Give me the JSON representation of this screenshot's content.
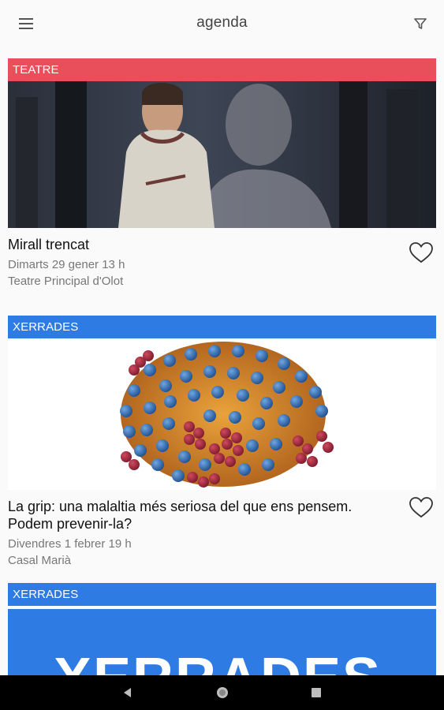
{
  "app": {
    "title": "agenda"
  },
  "events": [
    {
      "category": "TEATRE",
      "category_color": "#e84f5a",
      "title": "Mirall trencat",
      "date": "Dimarts 29 gener  13 h",
      "place": "Teatre Principal d'Olot"
    },
    {
      "category": "XERRADES",
      "category_color": "#2d7be3",
      "title": "La grip: una malaltia més seriosa del que ens pensem. Podem prevenir-la?",
      "date": "Divendres 1 febrer  19 h",
      "place": "Casal Marià"
    },
    {
      "category": "XERRADES",
      "category_color": "#2d7be3",
      "banner_text": "XERRADES"
    }
  ],
  "icons": {
    "menu": "hamburger-icon",
    "filter": "filter-icon",
    "favorite": "heart-outline-icon",
    "back": "back-triangle-icon",
    "home": "home-circle-icon",
    "recents": "recents-square-icon"
  }
}
